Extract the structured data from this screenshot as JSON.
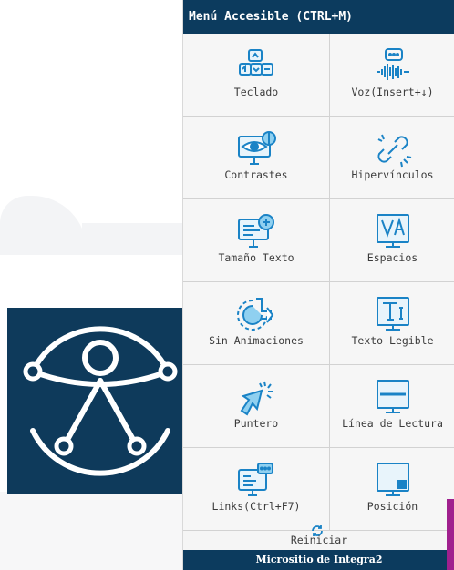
{
  "menu": {
    "title": "Menú Accesible (CTRL+M)",
    "items": [
      {
        "label": "Teclado",
        "icon": "keyboard-icon"
      },
      {
        "label": "Voz(Insert+↓)",
        "icon": "voice-icon"
      },
      {
        "label": "Contrastes",
        "icon": "contrast-icon"
      },
      {
        "label": "Hipervínculos",
        "icon": "hyperlink-icon"
      },
      {
        "label": "Tamaño Texto",
        "icon": "text-size-icon"
      },
      {
        "label": "Espacios",
        "icon": "spacing-icon"
      },
      {
        "label": "Sin Animaciones",
        "icon": "no-animation-icon"
      },
      {
        "label": "Texto Legible",
        "icon": "readable-text-icon"
      },
      {
        "label": "Puntero",
        "icon": "pointer-icon"
      },
      {
        "label": "Línea de Lectura",
        "icon": "reading-line-icon"
      },
      {
        "label": "Links(Ctrl+F7)",
        "icon": "links-icon"
      },
      {
        "label": "Posición",
        "icon": "position-icon"
      }
    ],
    "reset_label": "Reiniciar",
    "footer": "Micrositio de Integra2"
  },
  "colors": {
    "brand": "#0c3b5e",
    "icon_blue": "#1a83c6",
    "icon_light": "#8fd0f0",
    "accent": "#a0208e"
  }
}
